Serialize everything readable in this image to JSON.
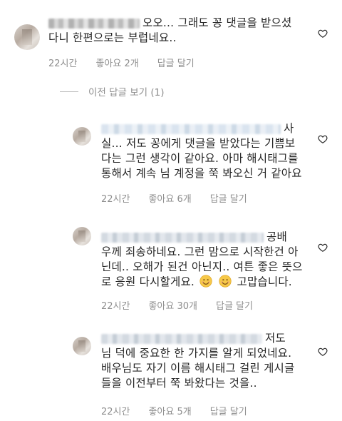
{
  "comments": [
    {
      "lines": [
        "오오... 그래도 꽁 댓글을 받으셨",
        "다니 한편으로는 부럽네요.."
      ],
      "time": "22시간",
      "likes": "좋아요 2개",
      "reply": "답글 달기"
    },
    {
      "lines": [
        "사",
        "실... 저도 꽁에게 댓글을 받았다는 기쁨보",
        "다는 그런 생각이 같아요. 아마 해시태그를",
        "통해서 계속 님 계정을 쭉 봐오신 거 같아요"
      ],
      "time": "22시간",
      "likes": "좋아요 6개",
      "reply": "답글 달기"
    },
    {
      "lines": [
        "공배",
        "우께 죄송하네요. 그런 맘으로 시작한건 아",
        "닌데.. 오해가 된건 아닌지.. 여튼 좋은 뜻으",
        "로 응원 다시할게요.",
        "고맙습니다."
      ],
      "time": "22시간",
      "likes": "좋아요 30개",
      "reply": "답글 달기"
    },
    {
      "lines": [
        "저도",
        "님 덕에 중요한 한 가지를 알게 되었네요.",
        "배우님도 자기 이름 해시태그 걸린 게시글",
        "들을 이전부터 쭉 봐왔다는 것을.."
      ],
      "time": "22시간",
      "likes": "좋아요 5개",
      "reply": "답글 달기"
    }
  ],
  "view_replies": "이전 답글 보기 (1)",
  "icons": {
    "like": "heart-icon",
    "emoji": "smiling-face-icon"
  },
  "colors": {
    "text": "#262626",
    "meta": "#8e8e8e",
    "heart": "#262626",
    "emoji": "#f7c948"
  }
}
